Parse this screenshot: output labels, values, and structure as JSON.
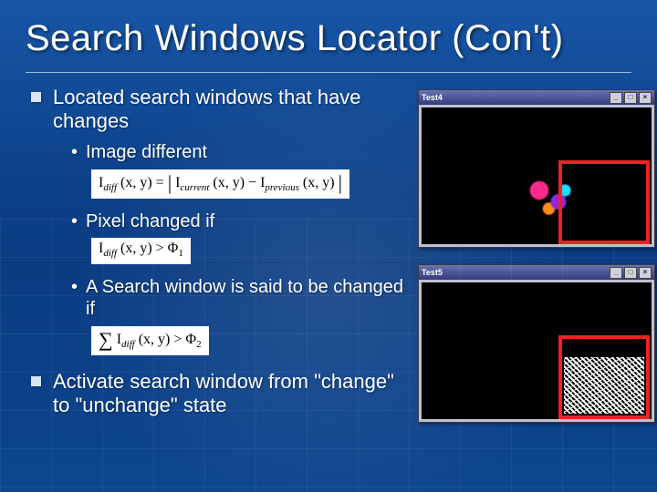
{
  "title": "Search Windows Locator (Con't)",
  "bullets": {
    "b1": "Located search windows that have changes",
    "b1a": "Image different",
    "b1b": "Pixel changed if",
    "b1c": "A Search window is said to be changed if",
    "b2": "Activate search window from \"change\" to \"unchange\" state"
  },
  "formulas": {
    "f1_html": "I<span class='sub italic'>diff</span> (x, y) = <span class='big'>|</span> I<span class='sub italic'>current</span> (x, y) − I<span class='sub italic'>previous</span> (x, y) <span class='big'>|</span>",
    "f2_html": "I<span class='sub italic'>diff</span> (x, y) &gt; Φ<span class='sub'>1</span>",
    "f3_html": "<span class='big'>∑</span> I<span class='sub italic'>diff</span> (x, y) &gt; Φ<span class='sub'>2</span>"
  },
  "windows": {
    "w1_title": "Test4",
    "w2_title": "Test5",
    "btn_min": "_",
    "btn_max": "□",
    "btn_close": "×"
  }
}
